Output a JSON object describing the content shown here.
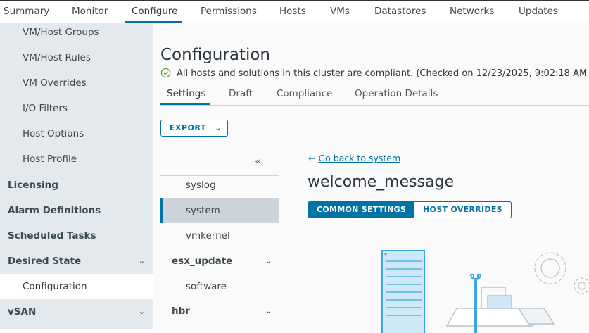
{
  "top_tabs": [
    "Summary",
    "Monitor",
    "Configure",
    "Permissions",
    "Hosts",
    "VMs",
    "Datastores",
    "Networks",
    "Updates"
  ],
  "sidebar": {
    "items": [
      {
        "label": "VM/Host Groups"
      },
      {
        "label": "VM/Host Rules"
      },
      {
        "label": "VM Overrides"
      },
      {
        "label": "I/O Filters"
      },
      {
        "label": "Host Options"
      },
      {
        "label": "Host Profile"
      },
      {
        "label": "Licensing"
      },
      {
        "label": "Alarm Definitions"
      },
      {
        "label": "Scheduled Tasks"
      },
      {
        "label": "Desired State"
      },
      {
        "label": "Configuration"
      },
      {
        "label": "vSAN"
      }
    ]
  },
  "page": {
    "title": "Configuration",
    "status": "All hosts and solutions in this cluster are compliant. (Checked on 12/23/2025, 9:02:18 AM",
    "tabs": [
      "Settings",
      "Draft",
      "Compliance",
      "Operation Details"
    ],
    "export_label": "EXPORT"
  },
  "tree": {
    "collapse_icon": "«",
    "items": [
      "syslog",
      "system",
      "vmkernel",
      "esx_update",
      "software",
      "hbr"
    ]
  },
  "detail": {
    "back_label": "Go back to system",
    "title": "welcome_message",
    "segments": [
      "COMMON SETTINGS",
      "HOST OVERRIDES"
    ]
  },
  "colors": {
    "accent": "#0072a3",
    "sidebar_bg": "#e4e9ee",
    "selected_bg": "#ccd3da",
    "success": "#5aa220"
  }
}
